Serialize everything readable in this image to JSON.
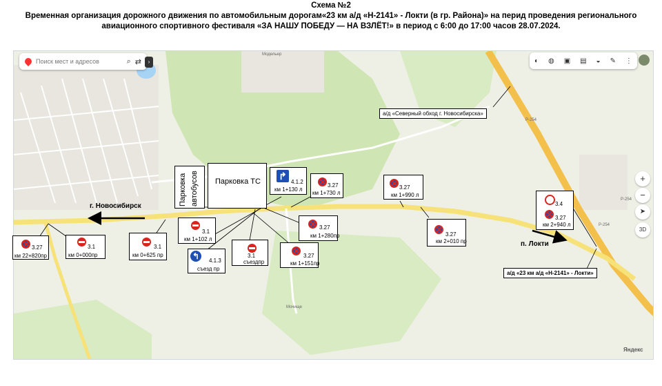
{
  "header": {
    "line1": "Схема №2",
    "line2": "Временная организация дорожного движения по автомобильным дорогам«23 км а/д «Н-2141» - Локти (в гр. Района)» на перид проведения регионального",
    "line3": "авиационного спортивного фестиваля «ЗА НАШУ ПОБЕДУ — НА ВЗЛЁТ!» в период с 6:00 до 17:00 часов 28.07.2024."
  },
  "map": {
    "search_placeholder": "Поиск мест и адресов",
    "brand": "Яндекс",
    "zoom_in": "+",
    "zoom_out": "−",
    "mode_3d": "3D",
    "places": {
      "modeller": "Модельер",
      "mochishche": "Мочище",
      "r254_a": "Р-254",
      "r254_b": "Р-254",
      "r254_c": "Р-254"
    },
    "colors": {
      "road": "#f7e27a",
      "highway": "#f2c04b",
      "forest": "#cfe6b4",
      "water": "#a7d3f5"
    }
  },
  "labels": {
    "city_novosibirsk": "г. Новосибирск",
    "city_lokti": "п. Локти",
    "north_bypass": "а/д «Северный обход г. Новосибирска»",
    "road_23km": "а/д «23 км а/д «Н-2141» - Локти»",
    "parking_buses_1": "Парковка",
    "parking_buses_2": "автобусов",
    "parking_ts": "Парковка ТС"
  },
  "signs": [
    {
      "code": "3.27",
      "km": "км 22+820пр",
      "icon": "no-stopping"
    },
    {
      "code": "3.1",
      "km": "км 0+000пр",
      "icon": "no-entry"
    },
    {
      "code": "3.1",
      "km": "км 0+625 пр",
      "icon": "no-entry"
    },
    {
      "code": "3.1",
      "km": "км 1+102 л",
      "icon": "no-entry"
    },
    {
      "code": "4.1.3",
      "km": "съезд пр",
      "icon": "turn-left"
    },
    {
      "code": "3.1",
      "km": "съездпр",
      "icon": "no-entry"
    },
    {
      "code": "3.27",
      "km": "км 1+151пр",
      "icon": "no-stopping"
    },
    {
      "code": "3.27",
      "km": "км 1+280пр",
      "icon": "no-stopping"
    },
    {
      "code": "4.1.2",
      "km": "км 1+130 л",
      "icon": "turn-right"
    },
    {
      "code": "3.27",
      "km": "км 1+730 л",
      "icon": "no-stopping"
    },
    {
      "code": "3.27",
      "km": "км 1+990 л",
      "icon": "no-stopping"
    },
    {
      "code": "3.27",
      "km": "км 2+010 пр",
      "icon": "no-stopping"
    },
    {
      "code": "3.4",
      "code2": "3.27",
      "km": "км 2+940 л",
      "icon": "no-trucks"
    }
  ]
}
